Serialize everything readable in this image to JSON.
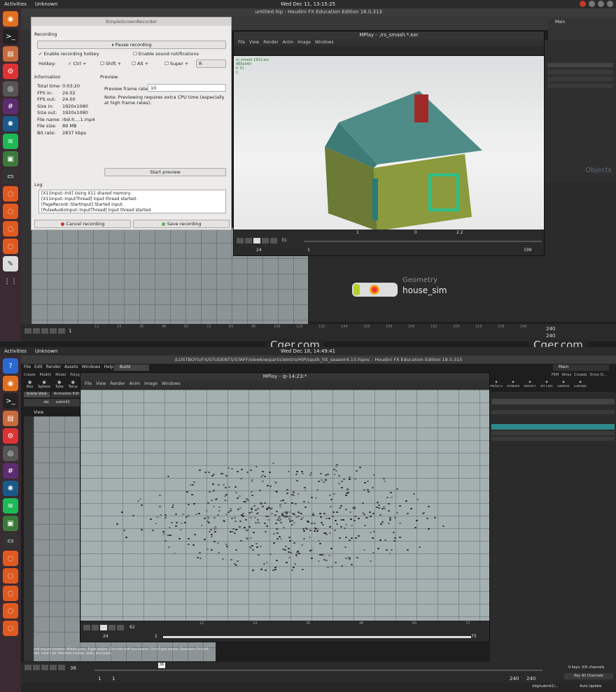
{
  "top": {
    "activities": "Activities",
    "app": "Unknown",
    "clock": "Wed Dec 11, 13:15:25",
    "window_title": "untitled.hip - Houdini FX Education Edition 18.0.313"
  },
  "bottom": {
    "activities": "Activities",
    "app": "Unknown",
    "clock": "Wed Dec 18, 14:49:41",
    "window_title": "/LOSTBOYS/FX/STUDENTS/STAFF/slewkiw/particleIntro/HIP/squib_hit_season4.15.hipnc - Houdini FX Education Edition 18.0.315"
  },
  "ssr": {
    "title": "SimpleScreenRecorder",
    "recording_label": "Recording",
    "pause_btn": "Pause recording",
    "enable_hotkey": "Enable recording hotkey",
    "enable_sound": "Enable sound notifications",
    "hotkey_label": "Hotkey:",
    "ctrl": "Ctrl +",
    "shift": "Shift +",
    "alt": "Alt +",
    "super": "Super +",
    "key": "R",
    "info_label": "Information",
    "info": [
      {
        "k": "Total time:",
        "v": "0:03:20"
      },
      {
        "k": "FPS in:",
        "v": "24.02"
      },
      {
        "k": "FPS out:",
        "v": "24.00"
      },
      {
        "k": "Size in:",
        "v": "1920x1080"
      },
      {
        "k": "Size out:",
        "v": "1920x1080"
      },
      {
        "k": "File name:",
        "v": "rbd-h....1.mp4"
      },
      {
        "k": "File size:",
        "v": "89 MB"
      },
      {
        "k": "Bit rate:",
        "v": "2837 kbps"
      }
    ],
    "preview_label": "Preview",
    "preview_rate_label": "Preview frame rate:",
    "preview_rate": "10",
    "preview_note": "Note: Previewing requires extra CPU time (especially at high frame rates).",
    "start_preview": "Start preview",
    "log_label": "Log",
    "log": [
      "[X11Input::Init] Using X11 shared memory.",
      "[X11Input::InputThread] Input thread started.",
      "[PageRecord::StartInput] Started input.",
      "[PulseAudioInput::InputThread] Input thread started."
    ],
    "cancel_btn": "Cancel recording",
    "save_btn": "Save recording"
  },
  "mplay1": {
    "title": "MPlay - ./rs_smash.*.exr",
    "menu": [
      "File",
      "View",
      "Render",
      "Anim",
      "Image",
      "Windows"
    ],
    "overlay": [
      "rs_smash.1932.exr",
      "960x540",
      "fr 31",
      "C"
    ],
    "frame": "31",
    "frame_field": "24",
    "start": "1",
    "end": "199",
    "gamma": "2.2",
    "val1": "1",
    "val2": "0"
  },
  "mplay2": {
    "title": "MPlay - ip-14:23:*",
    "menu": [
      "File",
      "View",
      "Render",
      "Anim",
      "Image",
      "Windows"
    ],
    "frame": "62",
    "frame_field": "24",
    "start": "1",
    "end": "75",
    "ticks": [
      "12",
      "24",
      "36",
      "48",
      "60",
      "72"
    ]
  },
  "node": {
    "type": "Geometry",
    "name": "house_sim",
    "objects_label": "Objects"
  },
  "timeline_top": {
    "frame": "1",
    "end1": "240",
    "end2": "240",
    "ticks": [
      "12",
      "24",
      "36",
      "48",
      "60",
      "72",
      "84",
      "96",
      "108",
      "120",
      "132",
      "144",
      "156",
      "168",
      "180",
      "192",
      "204",
      "216",
      "228",
      "240"
    ]
  },
  "timeline_bottom": {
    "frame": "36",
    "start": "1",
    "start2": "1",
    "end1": "240",
    "end2": "240",
    "keys": "0 keys, 0/0 channels",
    "key_all": "Key All Channels",
    "auto_update": "Auto Update",
    "path": "/obj/submit1/..."
  },
  "status_msg": "Left mouse tumbles. Middle pans. Right dollies. Ctrl+Alt+Left box-zooms. Ctrl+Right zooms. Spacebar-Ctrl-Left tilts. Hold L for alternate tumble, dolly, and zoom.",
  "watermark": "Cger.com",
  "houdini_menu": [
    "File",
    "Edit",
    "Render",
    "Assets",
    "Windows",
    "Help"
  ],
  "build": "Build",
  "main_label": "Main",
  "shelf_tabs_bottom": [
    "Create",
    "Modify",
    "Model",
    "Polygon"
  ],
  "shelf_tools": [
    "Box",
    "Sphere",
    "Tube",
    "Torus"
  ],
  "light_tools": [
    "Portal Light",
    "Ambient Light",
    "Stereo Camera",
    "VR Camera",
    "Switcher",
    "Gamepad Camera"
  ],
  "pane_tabs": [
    "Scene View",
    "Animation Edit..."
  ],
  "path_obj": "obj",
  "path_sub": "submit1",
  "view_label": "View",
  "shelf_right": [
    "FEM",
    "Wires",
    "Crowds",
    "Drive Si..."
  ],
  "colors": {
    "accent_green": "#7fbf3f",
    "node_green": "#b7d12b",
    "ssr_bg": "#ecebe9",
    "timeline_red": "#c0392b"
  }
}
